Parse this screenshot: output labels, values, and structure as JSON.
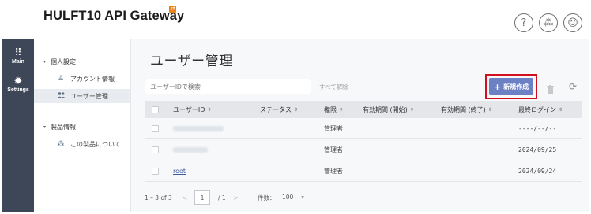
{
  "app": {
    "title": "HULFT10 API Gateway",
    "badge_icon": "swap-icon"
  },
  "header_icons": [
    {
      "name": "help-icon",
      "glyph": "?"
    },
    {
      "name": "apps-icon",
      "glyph": "⁂"
    },
    {
      "name": "user-icon",
      "glyph": "☺"
    }
  ],
  "rail": {
    "items": [
      {
        "label": "Main",
        "icon": "grid-icon",
        "glyph": "⠿"
      },
      {
        "label": "Settings",
        "icon": "gear-icon",
        "glyph": "✹"
      }
    ],
    "active": "Settings"
  },
  "nav": {
    "sections": [
      {
        "label": "個人設定",
        "items": [
          {
            "label": "アカウント情報",
            "icon": "user-outline-icon",
            "glyph": "♙"
          },
          {
            "label": "ユーザー管理",
            "icon": "users-icon",
            "glyph": "👥",
            "active": true
          }
        ]
      },
      {
        "label": "製品情報",
        "items": [
          {
            "label": "この製品について",
            "icon": "apps-icon",
            "glyph": "⁂"
          }
        ]
      }
    ]
  },
  "main": {
    "page_title": "ユーザー管理",
    "search_placeholder": "ユーザーIDで検索",
    "clear_all": "すべて解除",
    "create_button": "新規作成",
    "create_button_glyph": "+",
    "columns": [
      "ユーザーID",
      "ステータス",
      "権限",
      "有効期間 (開始)",
      "有効期間 (終了)",
      "最終ログイン"
    ],
    "rows": [
      {
        "user_id": "",
        "user_id_obscured": true,
        "status": "",
        "role": "管理者",
        "start": "",
        "end": "",
        "last_login": "----/--/--"
      },
      {
        "user_id": "",
        "user_id_obscured": true,
        "status": "",
        "role": "管理者",
        "start": "",
        "end": "",
        "last_login": "2024/09/25"
      },
      {
        "user_id": "root",
        "user_id_obscured": false,
        "status": "",
        "role": "管理者",
        "start": "",
        "end": "",
        "last_login": "2024/09/24"
      }
    ],
    "pager": {
      "range": "1 – 3 of 3",
      "prev_glyph": "<",
      "next_glyph": ">",
      "current_page": "1",
      "total_pages": "/ 1",
      "page_size_label": "件数：",
      "page_size": "100",
      "dropdown_glyph": "▾"
    }
  },
  "colors": {
    "rail_bg": "#3e4757",
    "create_button": "#6c80c4",
    "highlight_box": "#d40f1d",
    "link": "#3d5a9a"
  }
}
